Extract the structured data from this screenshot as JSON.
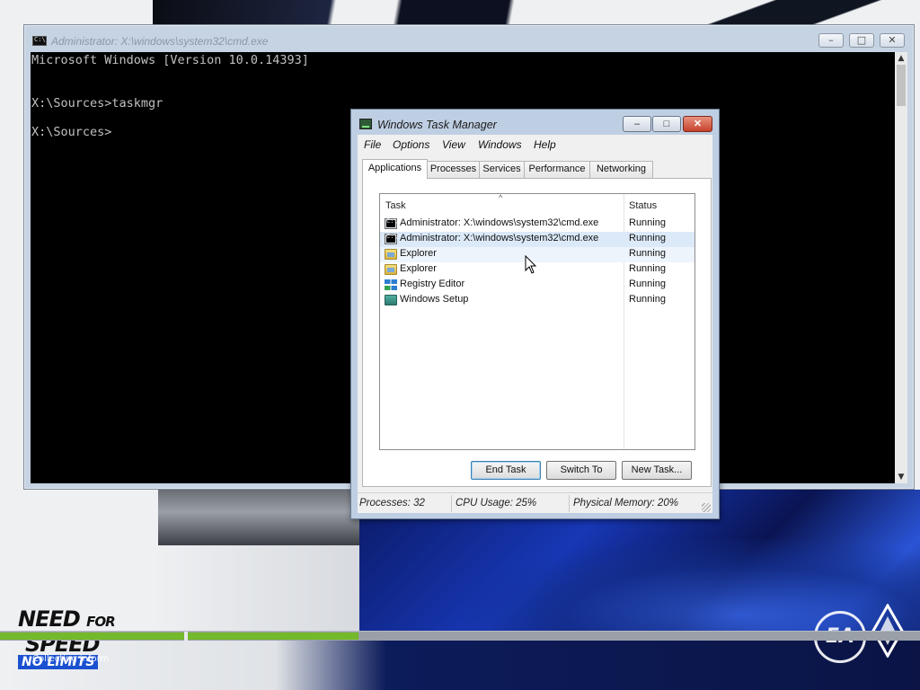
{
  "colors": {
    "cmd_bg": "#000000",
    "cmd_text": "#c0c0c0",
    "selection": "#dbe9f8",
    "progress_fill": "#74b82c",
    "close_button": "#c7412b"
  },
  "cmd_window": {
    "title": "Administrator: X:\\windows\\system32\\cmd.exe",
    "icon": "cmd-icon",
    "buttons": {
      "minimize": "–",
      "maximize": "□",
      "close": "✕"
    },
    "lines": [
      "Microsoft Windows [Version 10.0.14393]",
      "",
      "X:\\Sources>taskmgr",
      "",
      "X:\\Sources>"
    ]
  },
  "task_manager": {
    "title": "Windows Task Manager",
    "buttons": {
      "minimize": "–",
      "maximize": "□",
      "close": "✕"
    },
    "menu": [
      "File",
      "Options",
      "View",
      "Windows",
      "Help"
    ],
    "tabs": [
      "Applications",
      "Processes",
      "Services",
      "Performance",
      "Networking"
    ],
    "active_tab": "Applications",
    "columns": {
      "task": "Task",
      "status": "Status"
    },
    "tasks": [
      {
        "name": "Administrator: X:\\windows\\system32\\cmd.exe",
        "status": "Running",
        "icon": "cmd-icon"
      },
      {
        "name": "Administrator: X:\\windows\\system32\\cmd.exe",
        "status": "Running",
        "icon": "cmd-icon"
      },
      {
        "name": "Explorer",
        "status": "Running",
        "icon": "folder-icon"
      },
      {
        "name": "Explorer",
        "status": "Running",
        "icon": "folder-icon"
      },
      {
        "name": "Registry Editor",
        "status": "Running",
        "icon": "registry-icon"
      },
      {
        "name": "Windows Setup",
        "status": "Running",
        "icon": "setup-icon"
      }
    ],
    "actions": {
      "end_task": "End Task",
      "switch_to": "Switch To",
      "new_task": "New Task..."
    },
    "statusbar": {
      "processes": "Processes: 32",
      "cpu": "CPU Usage: 25%",
      "memory": "Physical Memory: 20%"
    }
  },
  "background": {
    "logo_line1_main": "NEED",
    "logo_line1_small": "FOR",
    "logo_line2": "SPEED",
    "logo_line3": "NO LIMITS",
    "publisher_logo": "EA",
    "status_text": "Collecting inform",
    "progress": 0.39
  }
}
